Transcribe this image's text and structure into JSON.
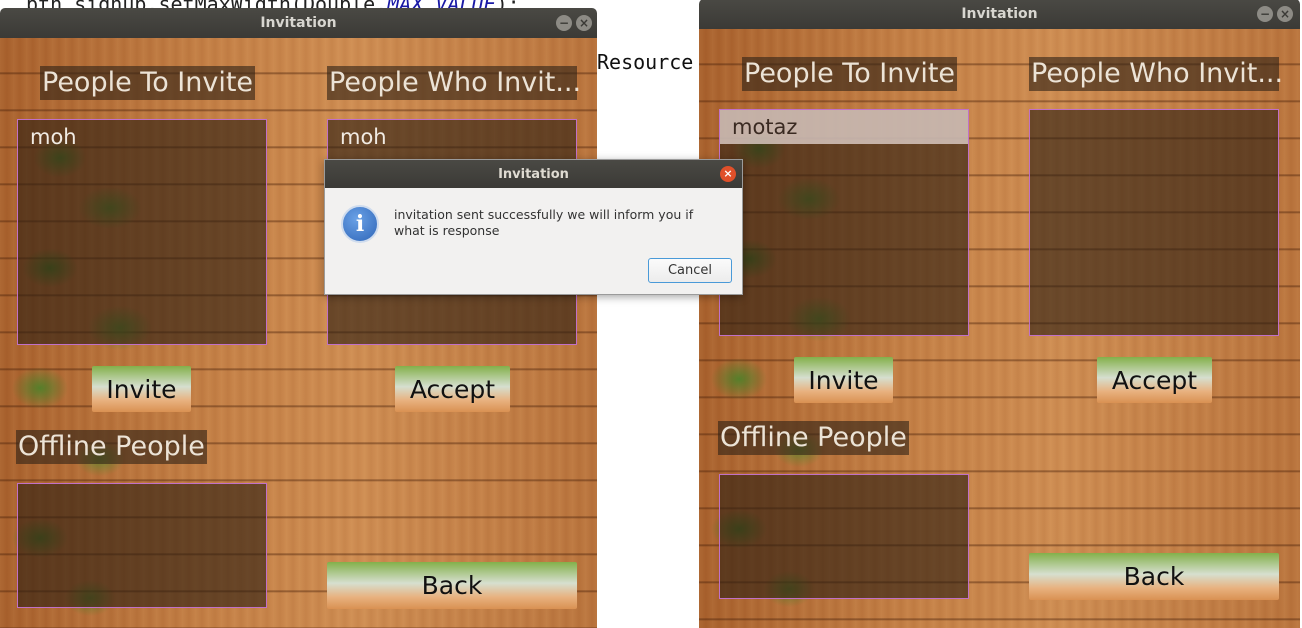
{
  "background": {
    "code_prefix": "btn_signup.setMaxWidth(Double.",
    "code_keyword": "MAX_VALUE",
    "code_suffix": ");",
    "resource_text": "Resource"
  },
  "left_window": {
    "title": "Invitation",
    "people_to_invite_label": "People To Invite",
    "people_who_invite_label": "People Who Invit...",
    "people_to_invite_items": [
      "moh"
    ],
    "people_who_invite_items": [
      "moh"
    ],
    "invite_button": "Invite",
    "accept_button": "Accept",
    "offline_label": "Offline People",
    "back_button": "Back"
  },
  "right_window": {
    "title": "Invitation",
    "people_to_invite_label": "People To Invite",
    "people_who_invite_label": "People Who Invit...",
    "people_to_invite_items": [
      "motaz"
    ],
    "invite_button": "Invite",
    "accept_button": "Accept",
    "offline_label": "Offline People",
    "back_button": "Back"
  },
  "dialog": {
    "title": "Invitation",
    "message": "invitation sent successfully we will inform you if what is response",
    "cancel_button": "Cancel"
  },
  "window_controls": {
    "minimize_glyph": "−",
    "close_glyph": "×"
  },
  "icons": {
    "info": "i"
  },
  "colors": {
    "titlebar": "#3b3a36",
    "list_border": "#c070c8",
    "dialog_close": "#e0502a",
    "info_icon": "#2f66b8"
  }
}
